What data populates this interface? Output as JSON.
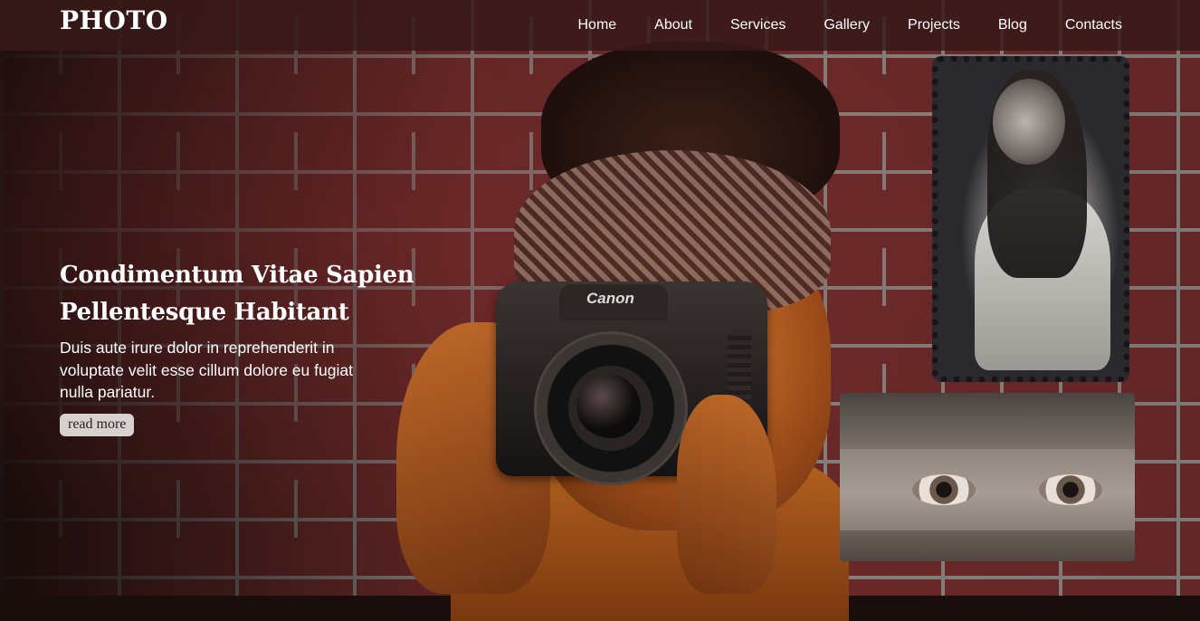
{
  "brand": {
    "logo": "PHOTO"
  },
  "nav": {
    "items": [
      "Home",
      "About",
      "Services",
      "Gallery",
      "Projects",
      "Blog",
      "Contacts"
    ]
  },
  "hero": {
    "title_line1": "Condimentum Vitae Sapien",
    "title_line2": "Pellentesque Habitant",
    "description": "Duis aute irure dolor in reprehenderit in voluptate velit esse cillum dolore eu fugiat nulla pariatur.",
    "cta_label": "read more",
    "camera_brand": "Canon"
  },
  "colors": {
    "navbar_bg": "#371919",
    "brick": "#6e2a2a",
    "button_bg": "#d7d1cf"
  }
}
